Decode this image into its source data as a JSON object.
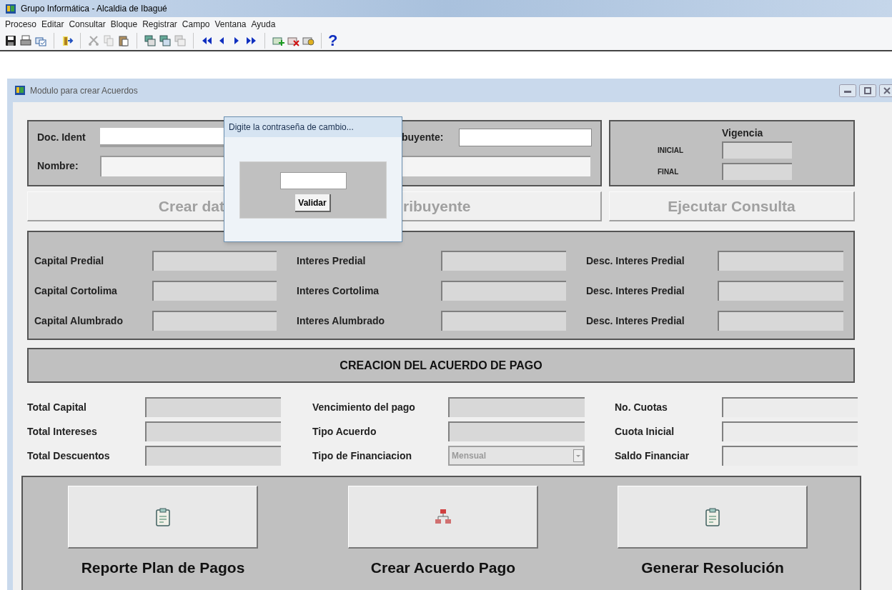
{
  "window": {
    "title": "Grupo Informática - Alcaldia de Ibagué"
  },
  "menu": [
    {
      "label": "Proceso"
    },
    {
      "label": "Editar"
    },
    {
      "label": "Consultar"
    },
    {
      "label": "Bloque"
    },
    {
      "label": "Registrar"
    },
    {
      "label": "Campo"
    },
    {
      "label": "Ventana"
    },
    {
      "label": "Ayuda"
    }
  ],
  "toolbar": {
    "help": "?"
  },
  "child_window": {
    "title": "Modulo para crear Acuerdos"
  },
  "contribuyente": {
    "doc_ident_label": "Doc. Ident",
    "tipo_label_visible": "buyente:",
    "nombre_label": "Nombre:"
  },
  "vigencia": {
    "title": "Vigencia",
    "inicial_label": "INICIAL",
    "final_label": "FINAL"
  },
  "actions": [
    {
      "parts": [
        "Crear dat",
        "ribuyente"
      ],
      "disabled": true
    },
    {
      "parts": [
        "Ejecutar Consulta"
      ],
      "disabled": true
    }
  ],
  "capital_rows": [
    {
      "items": [
        {
          "label": "Capital Predial"
        },
        {
          "label": "Interes Predial"
        },
        {
          "label": "Desc. Interes Predial"
        }
      ]
    },
    {
      "items": [
        {
          "label": "Capital Cortolima"
        },
        {
          "label": "Interes Cortolima"
        },
        {
          "label": "Desc. Interes Predial"
        }
      ]
    },
    {
      "items": [
        {
          "label": "Capital Alumbrado"
        },
        {
          "label": "Interes Alumbrado"
        },
        {
          "label": "Desc. Interes Predial"
        }
      ]
    }
  ],
  "section_header": "CREACION DEL ACUERDO DE PAGO",
  "acuerdo_rows": [
    {
      "items": [
        {
          "label": "Total Capital",
          "kind": "text"
        },
        {
          "label": "Vencimiento del pago",
          "kind": "text"
        },
        {
          "label": "No. Cuotas",
          "kind": "text"
        }
      ]
    },
    {
      "items": [
        {
          "label": "Total Intereses",
          "kind": "text"
        },
        {
          "label": "Tipo Acuerdo",
          "kind": "text"
        },
        {
          "label": "Cuota Inicial",
          "kind": "text"
        }
      ]
    },
    {
      "items": [
        {
          "label": "Total Descuentos",
          "kind": "text"
        },
        {
          "label": "Tipo de Financiacion",
          "kind": "dropdown",
          "value": "Mensual",
          "disabled": true
        },
        {
          "label": "Saldo Financiar",
          "kind": "text"
        }
      ]
    }
  ],
  "big_buttons": [
    {
      "label": "Reporte Plan de Pagos"
    },
    {
      "label": "Crear Acuerdo Pago"
    },
    {
      "label": "Generar Resolución"
    }
  ],
  "dialog": {
    "title": "Digite la contraseña de cambio...",
    "button": "Validar"
  }
}
